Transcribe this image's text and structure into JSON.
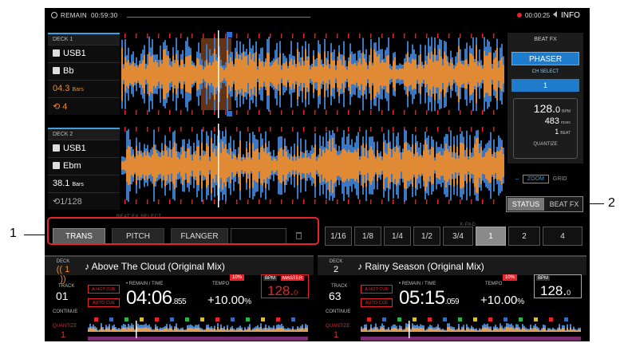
{
  "topbar": {
    "remain_label": "REMAIN",
    "remain_time": "00:59:30",
    "rec_time": "00:00:25",
    "info_label": "INFO"
  },
  "deck1_info": {
    "header": "DECK 1",
    "source": "USB1",
    "key": "Bb",
    "bars_value": "04.3",
    "bars_unit": "Bars",
    "loop": "4"
  },
  "deck2_info": {
    "header": "DECK 2",
    "source": "USB1",
    "key": "Ebm",
    "bars_value": "38.1",
    "bars_unit": "Bars",
    "loop": "1/128"
  },
  "beat_fx_panel": {
    "title": "BEAT FX",
    "effect": "PHASER",
    "ch_select_label": "CH SELECT",
    "ch_select_value": "1",
    "bpm_int": "128.",
    "bpm_dec": "0",
    "bpm_unit": "BPM",
    "msec_value": "483",
    "msec_unit": "msec",
    "beat_value": "1",
    "beat_unit": "BEAT",
    "quantize_label": "QUANTIZE"
  },
  "view_mode": {
    "dash": "–",
    "zoom": "ZOOM",
    "grid": "GRID"
  },
  "status_toggle": {
    "status": "STATUS",
    "beat_fx": "BEAT FX"
  },
  "beat_fx_select": {
    "label": "BEAT FX SELECT",
    "buttons": [
      "TRANS",
      "PITCH",
      "FLANGER",
      ""
    ]
  },
  "xpad": {
    "label": "X-PAD",
    "pads": [
      "1/16",
      "1/8",
      "1/4",
      "1/2",
      "3/4",
      "1",
      "2",
      "4"
    ],
    "selected": "1"
  },
  "deck1": {
    "deck_label": "DECK",
    "deck_num": "1",
    "track_title": "Above The Cloud (Original Mix)",
    "track_label": "TRACK",
    "track_num": "01",
    "a_hot_cue": "A.HOT CUE",
    "auto_cue": "AUTO CUE",
    "continue_label": "CONTINUE",
    "quantize_label": "QUANTIZE",
    "quantize_value": "1",
    "remain_label": "• REMAIN / TIME",
    "time_main": "04:06",
    "time_ms": ".855",
    "tempo_label": "TEMPO",
    "tempo_range": "10%",
    "tempo_value": "+10.00",
    "tempo_pct": "%",
    "bpm_label": "BPM",
    "master_label": "MASTER",
    "bpm_int": "128.",
    "bpm_dec": "0"
  },
  "deck2": {
    "deck_label": "DECK",
    "deck_num": "2",
    "track_title": "Rainy Season (Original Mix)",
    "track_label": "TRACK",
    "track_num": "63",
    "a_hot_cue": "A.HOT CUE",
    "auto_cue": "AUTO CUE",
    "continue_label": "CONTINUE",
    "quantize_label": "QUANTIZE",
    "quantize_value": "1",
    "remain_label": "• REMAIN / TIME",
    "time_main": "05:15",
    "time_ms": ".059",
    "tempo_label": "TEMPO",
    "tempo_range": "10%",
    "tempo_value": "+10.00",
    "tempo_pct": "%",
    "bpm_label": "BPM",
    "bpm_int": "128.",
    "bpm_dec": "0"
  },
  "callouts": {
    "one": "1",
    "two": "2"
  },
  "colors": {
    "accent_blue": "#1f7ccc",
    "wave_blue": "#3b78c4",
    "wave_orange": "#e08a35",
    "master_red": "#e8242a"
  }
}
